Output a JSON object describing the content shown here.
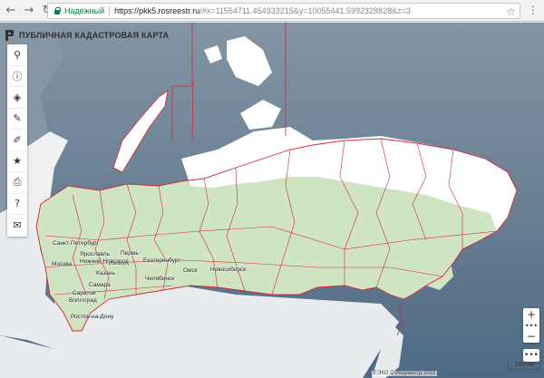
{
  "browser": {
    "secure_label": "Надежный",
    "url_host": "https://pkk5.rosreestr.ru",
    "url_rest": "/#x=11554711.454933215&y=10055441.5992328828&z=3"
  },
  "app": {
    "title": "ПУБЛИЧНАЯ КАДАСТРОВАЯ КАРТА"
  },
  "toolbar": {
    "items": [
      {
        "name": "search",
        "glyph": "⚲"
      },
      {
        "name": "info",
        "glyph": "ⓘ"
      },
      {
        "name": "layers",
        "glyph": "◈"
      },
      {
        "name": "draw",
        "glyph": "✎"
      },
      {
        "name": "measure",
        "glyph": "✐"
      },
      {
        "name": "favorites",
        "glyph": "★"
      },
      {
        "name": "print",
        "glyph": "⎙"
      },
      {
        "name": "help",
        "glyph": "?"
      },
      {
        "name": "mail",
        "glyph": "✉"
      }
    ]
  },
  "zoom": {
    "in": "+",
    "dots": "•••",
    "out": "−",
    "more": "•••"
  },
  "scale_label": "1000 км",
  "copyright": "ЕЭКО © Росреестр 2010",
  "cities": [
    {
      "label": "Санкт-Петербург"
    },
    {
      "label": "Пермь"
    },
    {
      "label": "Ярославль"
    },
    {
      "label": "Москва"
    },
    {
      "label": "Ижевск"
    },
    {
      "label": "Екатеринбург"
    },
    {
      "label": "Нижний Новгород"
    },
    {
      "label": "Казань"
    },
    {
      "label": "Омск"
    },
    {
      "label": "Новосибирск"
    },
    {
      "label": "Челябинск"
    },
    {
      "label": "Самара"
    },
    {
      "label": "Саратов"
    },
    {
      "label": "Волгоград"
    },
    {
      "label": "Ростов-на-Дону"
    }
  ],
  "colors": {
    "land": "#cfe5c2",
    "water": "#7f93a3",
    "arctic": "#ffffff",
    "border": "#d8253a",
    "secure": "#0b8043"
  }
}
